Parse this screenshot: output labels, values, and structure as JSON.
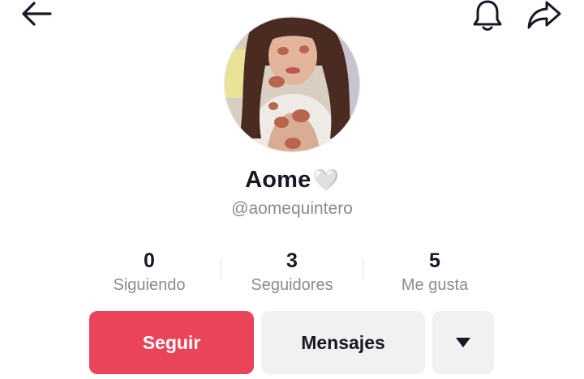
{
  "header": {
    "back_icon": "arrow-left-icon",
    "notification_icon": "bell-icon",
    "share_icon": "share-arrow-icon"
  },
  "profile": {
    "avatar": "profile-photo",
    "display_name": "Aome",
    "display_name_emoji": "🤍",
    "username": "@aomequintero"
  },
  "stats": {
    "following": {
      "count": "0",
      "label": "Siguiendo"
    },
    "followers": {
      "count": "3",
      "label": "Seguidores"
    },
    "likes": {
      "count": "5",
      "label": "Me gusta"
    }
  },
  "actions": {
    "follow_label": "Seguir",
    "message_label": "Mensajes",
    "more_icon": "caret-down-icon"
  },
  "colors": {
    "accent": "#ea4459",
    "secondary_button": "#f1f1f2",
    "muted_text": "#8a8b91",
    "text": "#161823"
  }
}
